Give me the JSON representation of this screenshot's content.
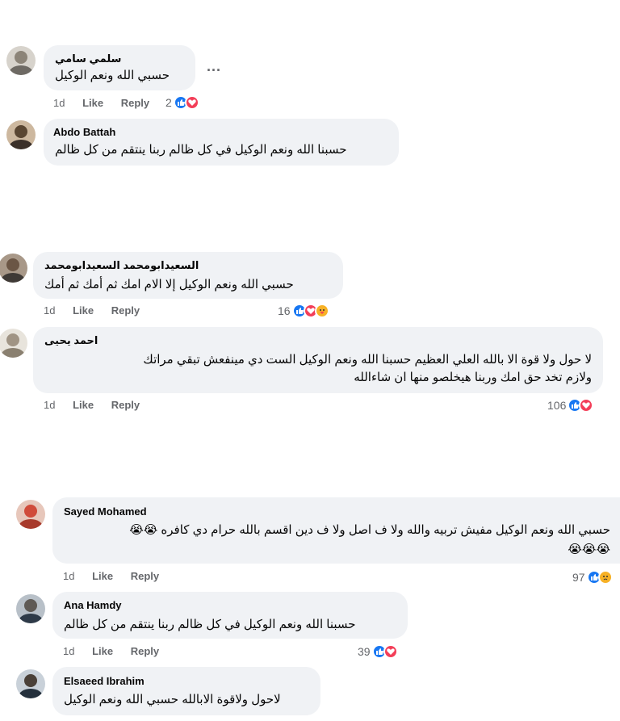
{
  "comments": [
    {
      "author": "سلمي سامي",
      "text": "حسبي الله ونعم الوكيل",
      "time": "1d",
      "like": "Like",
      "reply": "Reply",
      "reaction_count": "2",
      "reactions": [
        "like",
        "love"
      ],
      "more": "...",
      "avatar_color": "#9aa0a6"
    },
    {
      "author": "Abdo Battah",
      "text": "حسبنا الله ونعم الوكيل في كل ظالم ربنا ينتقم من كل ظالم",
      "avatar_color": "#5a4a3a"
    },
    {
      "author": "السعيدابومحمد السعيدابومحمد",
      "text": "حسبي الله ونعم الوكيل إلا الام امك ثم أمك ثم أمك",
      "time": "1d",
      "like": "Like",
      "reply": "Reply",
      "reaction_count": "16",
      "reactions": [
        "like",
        "love",
        "care"
      ],
      "avatar_color": "#7a6a5a"
    },
    {
      "author": "احمد يحيى",
      "text_line1": "لا حول ولا قوة الا بالله العلي العظيم حسبنا الله ونعم الوكيل الست دي مينفعش تبقي مراتك",
      "text_line2": "ولازم تخد حق امك وربنا هيخلصو منها ان شاءالله",
      "time": "1d",
      "like": "Like",
      "reply": "Reply",
      "reaction_count": "106",
      "reactions": [
        "like",
        "love"
      ],
      "avatar_color": "#b0a898"
    },
    {
      "author": "Sayed Mohamed",
      "text_line1": "حسبي الله ونعم الوكيل مفيش تربيه والله ولا ف اصل ولا ف دين اقسم بالله حرام دي كافره 😭😭",
      "text_line2": "😭😭😭",
      "time": "1d",
      "like": "Like",
      "reply": "Reply",
      "reaction_count": "97",
      "reactions": [
        "like",
        "sad"
      ],
      "avatar_color": "#c0392b"
    },
    {
      "author": "Ana Hamdy",
      "text": "حسبنا الله ونعم الوكيل في كل ظالم ربنا ينتقم من كل ظالم",
      "time": "1d",
      "like": "Like",
      "reply": "Reply",
      "reaction_count": "39",
      "reactions": [
        "like",
        "love"
      ],
      "avatar_color": "#6b7b8b"
    },
    {
      "author": "Elsaeed Ibrahim",
      "text": "لاحول ولاقوة الابالله حسبي الله ونعم الوكيل",
      "avatar_color": "#4a5a6a"
    }
  ]
}
